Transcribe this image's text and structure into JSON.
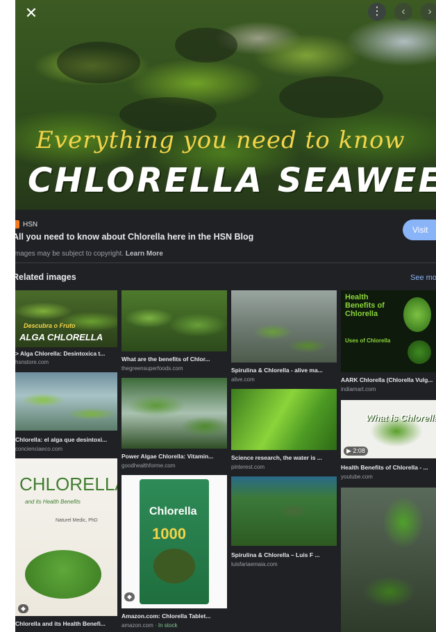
{
  "viewer": {
    "hero": {
      "script_text": "Everything you need to know",
      "title_text": "CHLORELLA SEAWEED"
    },
    "source": {
      "name": "HSN"
    },
    "page_title": "All you need to know about Chlorella here in the HSN Blog",
    "visit_label": "Visit",
    "copyright_text": "Images may be subject to copyright.",
    "learn_more_label": "Learn More",
    "related_heading": "Related images",
    "see_more_label": "See more"
  },
  "related": {
    "t1": {
      "caption": "> Alga Chlorella: Desintoxica t...",
      "domain": "hsnstore.com",
      "overlay_script": "Descubra o Fruto",
      "overlay_title": "ALGA CHLORELLA"
    },
    "t2": {
      "caption": "Chlorella: el alga que desintoxi...",
      "domain": "concienciaeco.com"
    },
    "t3": {
      "caption": "Chlorella and its Health Benefi...",
      "overlay_title": "CHLORELLA",
      "overlay_sub": "and its Health Benefits",
      "overlay_author": "Naturel Medic, PhD"
    },
    "t4": {
      "caption": "What are the benefits of Chlor...",
      "domain": "thegreensuperfoods.com"
    },
    "t5": {
      "caption": "Power Algae Chlorella: Vitamin...",
      "domain": "goodhealthforme.com"
    },
    "t6": {
      "caption": "Amazon.com: Chlorella Tablet...",
      "domain": "amazon.com",
      "stock": "In stock",
      "pkg_name": "Chlorella",
      "pkg_count": "1000"
    },
    "t7": {
      "caption": "Spirulina & Chlorella - alive ma...",
      "domain": "alive.com"
    },
    "t8": {
      "caption": "Science research, the water is ...",
      "domain": "pinterest.com"
    },
    "t9": {
      "caption": "Spirulina & Chlorella – Luis F ...",
      "domain": "luisfariaemaia.com"
    },
    "t10": {
      "caption": "AARK Chlorella (Chlorella Vulg...",
      "domain": "indiamart.com",
      "overlay_title": "Health Benefits of Chlorella",
      "overlay_sub": "Uses of Chlorella"
    },
    "t11": {
      "caption": "Health Benefits of Chlorella - ...",
      "domain": "youtube.com",
      "overlay_title": "What is Chlorella?",
      "duration": "2:08"
    }
  },
  "colors": {
    "panel": "#202124",
    "accent": "#8ab4f8",
    "stock": "#81c995"
  },
  "icons": [
    "close-icon",
    "more-vert-icon",
    "prev-icon",
    "next-icon",
    "play-icon"
  ]
}
